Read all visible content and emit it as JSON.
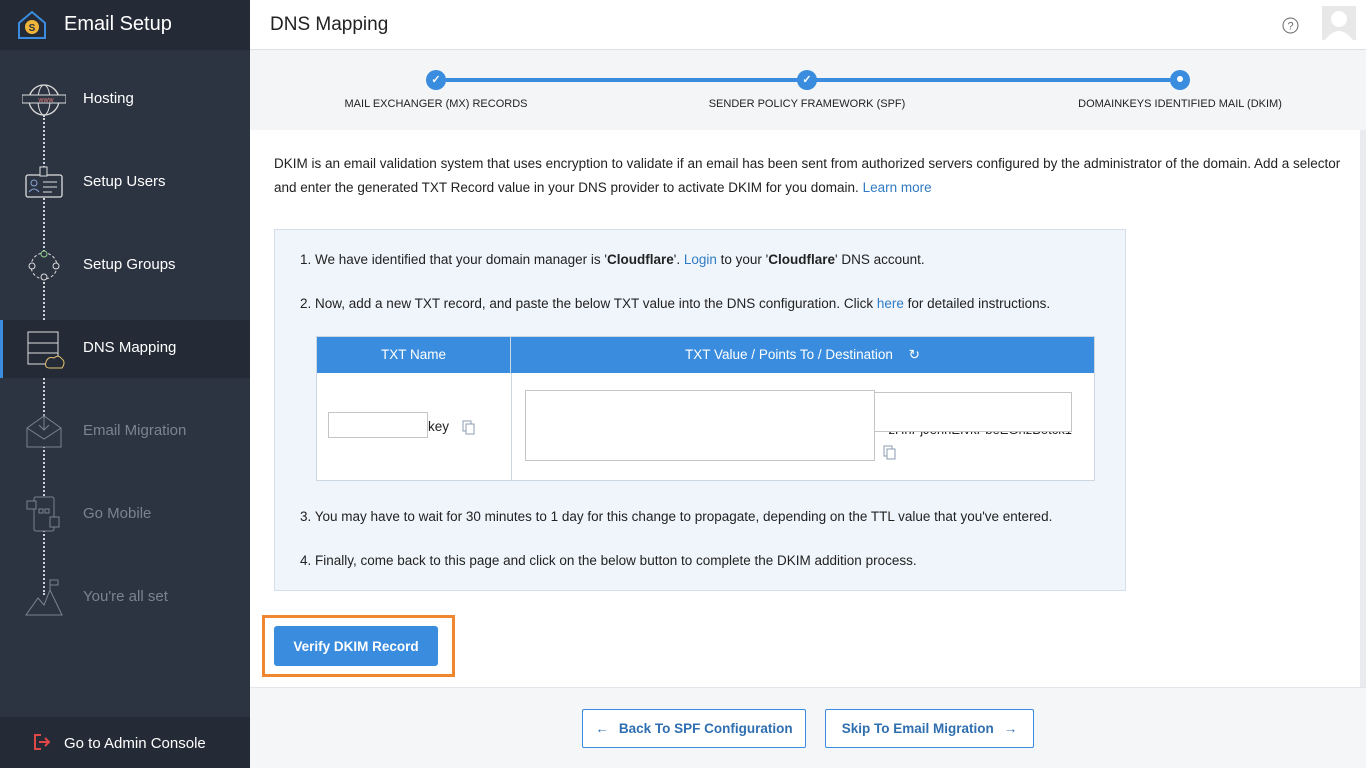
{
  "app": {
    "title": "Email Setup"
  },
  "sidebar": {
    "items": [
      {
        "label": "Hosting",
        "icon": "globe-www-icon",
        "state": "done"
      },
      {
        "label": "Setup Users",
        "icon": "id-card-icon",
        "state": "done"
      },
      {
        "label": "Setup Groups",
        "icon": "group-icon",
        "state": "done"
      },
      {
        "label": "DNS Mapping",
        "icon": "dns-cloud-icon",
        "state": "active"
      },
      {
        "label": "Email Migration",
        "icon": "mail-download-icon",
        "state": "disabled"
      },
      {
        "label": "Go Mobile",
        "icon": "mobile-apps-icon",
        "state": "disabled"
      },
      {
        "label": "You're all set",
        "icon": "mountain-flag-icon",
        "state": "disabled"
      }
    ],
    "footer": "Go to Admin Console"
  },
  "header": {
    "title": "DNS Mapping",
    "help_icon": "help-icon",
    "avatar_icon": "user-avatar-icon"
  },
  "stepper": {
    "steps": [
      {
        "label": "MAIL EXCHANGER (MX) RECORDS",
        "status": "completed"
      },
      {
        "label": "SENDER POLICY FRAMEWORK (SPF)",
        "status": "completed"
      },
      {
        "label": "DOMAINKEYS IDENTIFIED MAIL (DKIM)",
        "status": "current"
      }
    ]
  },
  "intro": {
    "text": "DKIM is an email validation system that uses encryption to validate if an email has been sent from authorized servers configured by the administrator of the domain. Add a selector and enter the generated TXT Record value in your DNS provider to activate DKIM for you domain. ",
    "link": "Learn more"
  },
  "instructions": {
    "s1a": "1. We have identified that your domain manager is '",
    "s1b": "Cloudflare",
    "s1c": "'. ",
    "s1link": "Login",
    "s1d": " to your '",
    "s1e": "Cloudflare",
    "s1f": "' DNS account.",
    "s2a": "2. Now, add a new TXT record, and paste the below TXT value into the DNS configuration. Click ",
    "s2link": "here",
    "s2b": " for detailed instructions.",
    "s3": "3. You may have to wait for 30 minutes to 1 day for this change to propagate, depending on the TTL value that you've entered.",
    "s4": "4. Finally, come back to this page and click on the below button to complete the DKIM addition process."
  },
  "table": {
    "headers": [
      "TXT Name",
      "TXT Value / Points To / Destination"
    ],
    "name_suffix": "key",
    "name_value": "",
    "value_tail": "zHhPjJehhEIvkPbeEGhzBotck1",
    "value_value": ""
  },
  "buttons": {
    "verify": "Verify DKIM Record",
    "back": "Back To SPF Configuration",
    "skip": "Skip To Email Migration"
  },
  "colors": {
    "accent": "#3a8dde",
    "highlight": "#f0862e",
    "sidebar": "#2c3341"
  }
}
